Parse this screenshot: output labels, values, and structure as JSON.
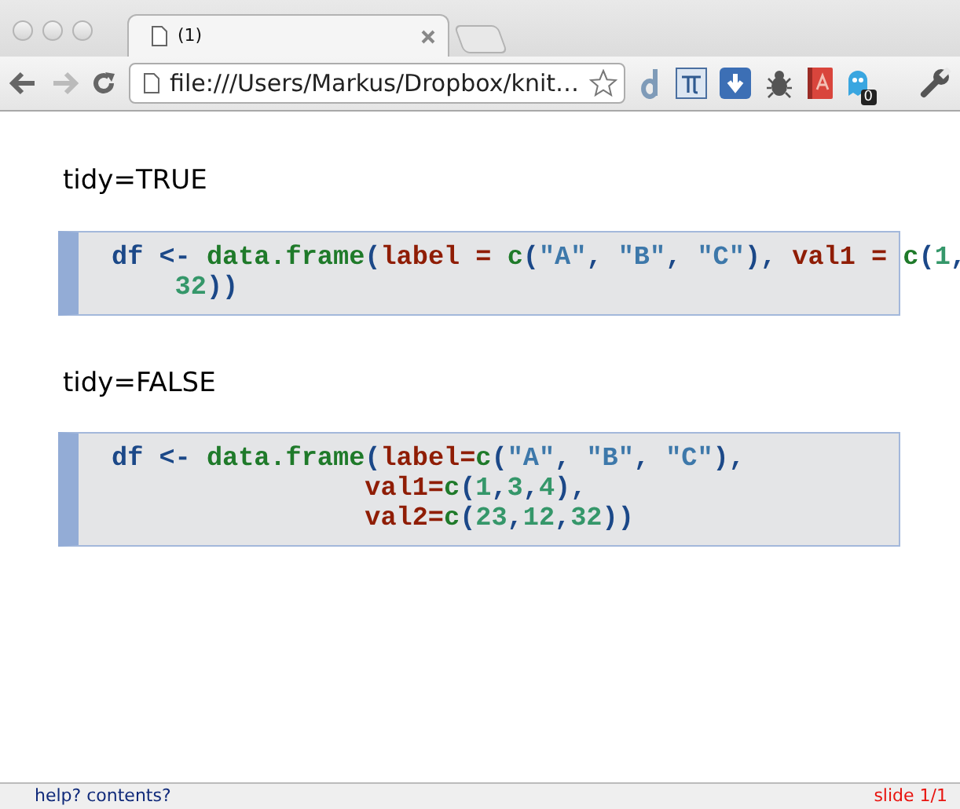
{
  "browser": {
    "tabs": [
      {
        "title": "(1)",
        "selected": true
      }
    ],
    "address": "file:///Users/Markus/Dropbox/knit…",
    "extension_badge": "0"
  },
  "sections": [
    {
      "heading": "tidy=TRUE",
      "code": [
        {
          "kind": "start",
          "tokens": [
            {
              "kind": "var",
              "t": "df <- "
            },
            {
              "kind": "func",
              "t": "data.frame"
            },
            {
              "kind": "punct",
              "t": "("
            },
            {
              "kind": "arg",
              "t": "label = "
            },
            {
              "kind": "func",
              "t": "c"
            },
            {
              "kind": "punct",
              "t": "("
            },
            {
              "kind": "str",
              "t": "\"A\""
            },
            {
              "kind": "punct",
              "t": ", "
            },
            {
              "kind": "str",
              "t": "\"B\""
            },
            {
              "kind": "punct",
              "t": ", "
            },
            {
              "kind": "str",
              "t": "\"C\""
            },
            {
              "kind": "punct",
              "t": "), "
            },
            {
              "kind": "arg",
              "t": "val1 = "
            },
            {
              "kind": "func",
              "t": "c"
            },
            {
              "kind": "punct",
              "t": "("
            },
            {
              "kind": "num",
              "t": "1"
            },
            {
              "kind": "punct",
              "t": ","
            }
          ]
        },
        {
          "kind": "wrap",
          "tokens": [
            {
              "kind": "num",
              "t": "32"
            },
            {
              "kind": "punct",
              "t": "))"
            }
          ]
        }
      ]
    },
    {
      "heading": "tidy=FALSE",
      "code": [
        {
          "kind": "start",
          "tokens": [
            {
              "kind": "var",
              "t": "df <- "
            },
            {
              "kind": "func",
              "t": "data.frame"
            },
            {
              "kind": "punct",
              "t": "("
            },
            {
              "kind": "arg",
              "t": "label="
            },
            {
              "kind": "func",
              "t": "c"
            },
            {
              "kind": "punct",
              "t": "("
            },
            {
              "kind": "str",
              "t": "\"A\""
            },
            {
              "kind": "punct",
              "t": ", "
            },
            {
              "kind": "str",
              "t": "\"B\""
            },
            {
              "kind": "punct",
              "t": ", "
            },
            {
              "kind": "str",
              "t": "\"C\""
            },
            {
              "kind": "punct",
              "t": "),"
            }
          ]
        },
        {
          "kind": "aligned",
          "tokens": [
            {
              "kind": "arg",
              "t": "val1="
            },
            {
              "kind": "func",
              "t": "c"
            },
            {
              "kind": "punct",
              "t": "("
            },
            {
              "kind": "num",
              "t": "1"
            },
            {
              "kind": "punct",
              "t": ","
            },
            {
              "kind": "num",
              "t": "3"
            },
            {
              "kind": "punct",
              "t": ","
            },
            {
              "kind": "num",
              "t": "4"
            },
            {
              "kind": "punct",
              "t": "),"
            }
          ]
        },
        {
          "kind": "aligned",
          "tokens": [
            {
              "kind": "arg",
              "t": "val2="
            },
            {
              "kind": "func",
              "t": "c"
            },
            {
              "kind": "punct",
              "t": "("
            },
            {
              "kind": "num",
              "t": "23"
            },
            {
              "kind": "punct",
              "t": ","
            },
            {
              "kind": "num",
              "t": "12"
            },
            {
              "kind": "punct",
              "t": ","
            },
            {
              "kind": "num",
              "t": "32"
            },
            {
              "kind": "punct",
              "t": "))"
            }
          ]
        }
      ]
    }
  ],
  "footer": {
    "left": "help? contents?",
    "right": "slide 1/1"
  }
}
